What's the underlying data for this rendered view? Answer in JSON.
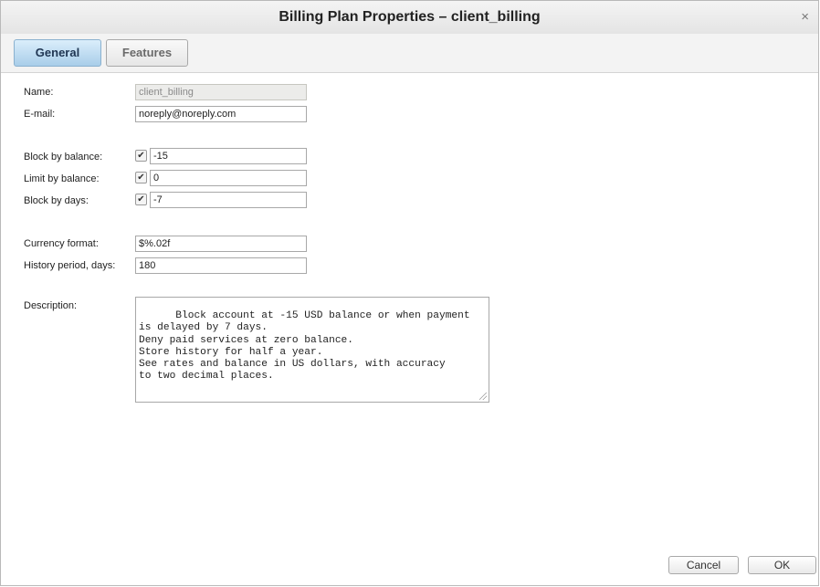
{
  "window": {
    "title": "Billing Plan Properties – client_billing",
    "close_glyph": "×"
  },
  "tabs": [
    {
      "label": "General",
      "active": true
    },
    {
      "label": "Features",
      "active": false
    }
  ],
  "form": {
    "name": {
      "label": "Name:",
      "value": "client_billing",
      "disabled": true
    },
    "email": {
      "label": "E-mail:",
      "value": "noreply@noreply.com"
    },
    "block_by_balance": {
      "label": "Block by balance:",
      "checked": true,
      "value": "-15"
    },
    "limit_by_balance": {
      "label": "Limit by balance:",
      "checked": true,
      "value": "0"
    },
    "block_by_days": {
      "label": "Block by days:",
      "checked": true,
      "value": "-7"
    },
    "currency_format": {
      "label": "Currency format:",
      "value": "$%.02f"
    },
    "history_period": {
      "label": "History period, days:",
      "value": "180"
    },
    "description": {
      "label": "Description:",
      "value": "Block account at -15 USD balance or when payment\nis delayed by 7 days.\nDeny paid services at zero balance.\nStore history for half a year.\nSee rates and balance in US dollars, with accuracy\nto two decimal places."
    }
  },
  "buttons": {
    "cancel": "Cancel",
    "ok": "OK"
  },
  "icons": {
    "checkmark": "✔"
  },
  "colors": {
    "active_tab": "#a8cde9",
    "disabled_field": "#ececea"
  }
}
